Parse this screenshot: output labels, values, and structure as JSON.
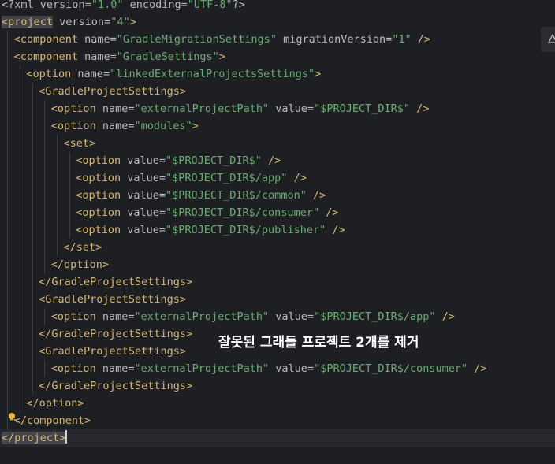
{
  "lines": [
    {
      "kind": "pi",
      "indent": 0,
      "text": "<?xml version=\"1.0\" encoding=\"UTF-8\"?>",
      "tokens": [
        {
          "t": "<?",
          "c": "t-pi"
        },
        {
          "t": "xml ",
          "c": "t-pi"
        },
        {
          "t": "version",
          "c": "t-attr"
        },
        {
          "t": "=",
          "c": "t-eq"
        },
        {
          "t": "\"1.0\"",
          "c": "t-val"
        },
        {
          "t": " encoding",
          "c": "t-attr"
        },
        {
          "t": "=",
          "c": "t-eq"
        },
        {
          "t": "\"UTF-8\"",
          "c": "t-val"
        },
        {
          "t": "?>",
          "c": "t-pi"
        }
      ]
    },
    {
      "kind": "open",
      "indent": 0,
      "highlight": true,
      "tokens": [
        {
          "t": "<project",
          "c": "t-name",
          "hl": true
        },
        {
          "t": " version",
          "c": "t-attr"
        },
        {
          "t": "=",
          "c": "t-eq"
        },
        {
          "t": "\"4\"",
          "c": "t-val"
        },
        {
          "t": ">",
          "c": "t-br"
        }
      ]
    },
    {
      "kind": "open",
      "indent": 1,
      "tokens": [
        {
          "t": "<component",
          "c": "t-name"
        },
        {
          "t": " name",
          "c": "t-attr"
        },
        {
          "t": "=",
          "c": "t-eq"
        },
        {
          "t": "\"GradleMigrationSettings\"",
          "c": "t-val"
        },
        {
          "t": " migrationVersion",
          "c": "t-attr"
        },
        {
          "t": "=",
          "c": "t-eq"
        },
        {
          "t": "\"1\"",
          "c": "t-val"
        },
        {
          "t": " />",
          "c": "t-br"
        }
      ]
    },
    {
      "kind": "open",
      "indent": 1,
      "tokens": [
        {
          "t": "<component",
          "c": "t-name"
        },
        {
          "t": " name",
          "c": "t-attr"
        },
        {
          "t": "=",
          "c": "t-eq"
        },
        {
          "t": "\"GradleSettings\"",
          "c": "t-val"
        },
        {
          "t": ">",
          "c": "t-br"
        }
      ]
    },
    {
      "kind": "open",
      "indent": 2,
      "tokens": [
        {
          "t": "<option",
          "c": "t-name"
        },
        {
          "t": " name",
          "c": "t-attr"
        },
        {
          "t": "=",
          "c": "t-eq"
        },
        {
          "t": "\"linkedExternalProjectsSettings\"",
          "c": "t-val"
        },
        {
          "t": ">",
          "c": "t-br"
        }
      ]
    },
    {
      "kind": "open",
      "indent": 3,
      "tokens": [
        {
          "t": "<GradleProjectSettings>",
          "c": "t-name"
        }
      ]
    },
    {
      "kind": "open",
      "indent": 4,
      "tokens": [
        {
          "t": "<option",
          "c": "t-name"
        },
        {
          "t": " name",
          "c": "t-attr"
        },
        {
          "t": "=",
          "c": "t-eq"
        },
        {
          "t": "\"externalProjectPath\"",
          "c": "t-val"
        },
        {
          "t": " value",
          "c": "t-attr"
        },
        {
          "t": "=",
          "c": "t-eq"
        },
        {
          "t": "\"$PROJECT_DIR$\"",
          "c": "t-val"
        },
        {
          "t": " />",
          "c": "t-br"
        }
      ]
    },
    {
      "kind": "open",
      "indent": 4,
      "tokens": [
        {
          "t": "<option",
          "c": "t-name"
        },
        {
          "t": " name",
          "c": "t-attr"
        },
        {
          "t": "=",
          "c": "t-eq"
        },
        {
          "t": "\"modules\"",
          "c": "t-val"
        },
        {
          "t": ">",
          "c": "t-br"
        }
      ]
    },
    {
      "kind": "open",
      "indent": 5,
      "tokens": [
        {
          "t": "<set>",
          "c": "t-name"
        }
      ]
    },
    {
      "kind": "open",
      "indent": 6,
      "tokens": [
        {
          "t": "<option",
          "c": "t-name"
        },
        {
          "t": " value",
          "c": "t-attr"
        },
        {
          "t": "=",
          "c": "t-eq"
        },
        {
          "t": "\"$PROJECT_DIR$\"",
          "c": "t-val"
        },
        {
          "t": " />",
          "c": "t-br"
        }
      ]
    },
    {
      "kind": "open",
      "indent": 6,
      "tokens": [
        {
          "t": "<option",
          "c": "t-name"
        },
        {
          "t": " value",
          "c": "t-attr"
        },
        {
          "t": "=",
          "c": "t-eq"
        },
        {
          "t": "\"$PROJECT_DIR$/app\"",
          "c": "t-val"
        },
        {
          "t": " />",
          "c": "t-br"
        }
      ]
    },
    {
      "kind": "open",
      "indent": 6,
      "tokens": [
        {
          "t": "<option",
          "c": "t-name"
        },
        {
          "t": " value",
          "c": "t-attr"
        },
        {
          "t": "=",
          "c": "t-eq"
        },
        {
          "t": "\"$PROJECT_DIR$/common\"",
          "c": "t-val"
        },
        {
          "t": " />",
          "c": "t-br"
        }
      ]
    },
    {
      "kind": "open",
      "indent": 6,
      "tokens": [
        {
          "t": "<option",
          "c": "t-name"
        },
        {
          "t": " value",
          "c": "t-attr"
        },
        {
          "t": "=",
          "c": "t-eq"
        },
        {
          "t": "\"$PROJECT_DIR$/consumer\"",
          "c": "t-val"
        },
        {
          "t": " />",
          "c": "t-br"
        }
      ]
    },
    {
      "kind": "open",
      "indent": 6,
      "tokens": [
        {
          "t": "<option",
          "c": "t-name"
        },
        {
          "t": " value",
          "c": "t-attr"
        },
        {
          "t": "=",
          "c": "t-eq"
        },
        {
          "t": "\"$PROJECT_DIR$/publisher\"",
          "c": "t-val"
        },
        {
          "t": " />",
          "c": "t-br"
        }
      ]
    },
    {
      "kind": "close",
      "indent": 5,
      "tokens": [
        {
          "t": "</set>",
          "c": "t-name"
        }
      ]
    },
    {
      "kind": "close",
      "indent": 4,
      "tokens": [
        {
          "t": "</option>",
          "c": "t-name"
        }
      ]
    },
    {
      "kind": "close",
      "indent": 3,
      "tokens": [
        {
          "t": "</GradleProjectSettings>",
          "c": "t-name"
        }
      ]
    },
    {
      "kind": "open",
      "indent": 3,
      "tokens": [
        {
          "t": "<GradleProjectSettings>",
          "c": "t-name"
        }
      ]
    },
    {
      "kind": "open",
      "indent": 4,
      "tokens": [
        {
          "t": "<option",
          "c": "t-name"
        },
        {
          "t": " name",
          "c": "t-attr"
        },
        {
          "t": "=",
          "c": "t-eq"
        },
        {
          "t": "\"externalProjectPath\"",
          "c": "t-val"
        },
        {
          "t": " value",
          "c": "t-attr"
        },
        {
          "t": "=",
          "c": "t-eq"
        },
        {
          "t": "\"$PROJECT_DIR$/app\"",
          "c": "t-val"
        },
        {
          "t": " />",
          "c": "t-br"
        }
      ]
    },
    {
      "kind": "close",
      "indent": 3,
      "tokens": [
        {
          "t": "</GradleProjectSettings>",
          "c": "t-name"
        }
      ]
    },
    {
      "kind": "open",
      "indent": 3,
      "tokens": [
        {
          "t": "<GradleProjectSettings>",
          "c": "t-name"
        }
      ]
    },
    {
      "kind": "open",
      "indent": 4,
      "tokens": [
        {
          "t": "<option",
          "c": "t-name"
        },
        {
          "t": " name",
          "c": "t-attr"
        },
        {
          "t": "=",
          "c": "t-eq"
        },
        {
          "t": "\"externalProjectPath\"",
          "c": "t-val"
        },
        {
          "t": " value",
          "c": "t-attr"
        },
        {
          "t": "=",
          "c": "t-eq"
        },
        {
          "t": "\"$PROJECT_DIR$/consumer\"",
          "c": "t-val"
        },
        {
          "t": " />",
          "c": "t-br"
        }
      ]
    },
    {
      "kind": "close",
      "indent": 3,
      "tokens": [
        {
          "t": "</GradleProjectSettings>",
          "c": "t-name"
        }
      ]
    },
    {
      "kind": "close",
      "indent": 2,
      "tokens": [
        {
          "t": "</option>",
          "c": "t-name"
        }
      ]
    },
    {
      "kind": "close",
      "indent": 1,
      "bulb": true,
      "tokens": [
        {
          "t": "</component>",
          "c": "t-name"
        }
      ]
    },
    {
      "kind": "close",
      "indent": 0,
      "current": true,
      "caret": true,
      "tokens": [
        {
          "t": "</project>",
          "c": "t-name",
          "hl": true
        }
      ]
    }
  ],
  "overlay_caption": "잘못된 그래들 프로젝트 2개를 제거",
  "icons": {
    "intention_bulb": "lightbulb-icon",
    "side_tab": "ai-assistant-icon"
  },
  "colors": {
    "background": "#1e1f22",
    "tag": "#d5b778",
    "attribute": "#bababa",
    "string": "#6aab73",
    "text": "#bcbec4"
  }
}
